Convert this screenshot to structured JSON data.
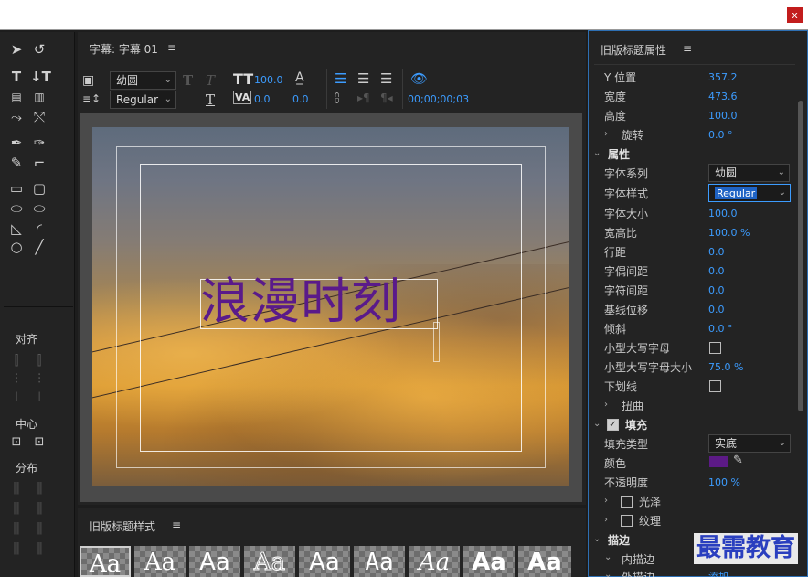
{
  "window": {
    "close_label": "x"
  },
  "title_panel": {
    "title": "字幕: 字幕 01",
    "menu_icon": "≡"
  },
  "toolbar": {
    "font_family": "幼圆",
    "font_style": "Regular",
    "font_size": "100.0",
    "tracking": "0.0",
    "kerning": "0.0",
    "timecode": "00;00;00;03"
  },
  "tools": {
    "align_label": "对齐",
    "center_label": "中心",
    "distribute_label": "分布"
  },
  "canvas": {
    "title_text": "浪漫时刻",
    "text_color": "#5a1a8a"
  },
  "properties_panel": {
    "title": "旧版标题属性",
    "menu_icon": "≡",
    "rows": [
      {
        "label": "Y 位置",
        "value": "357.2"
      },
      {
        "label": "宽度",
        "value": "473.6"
      },
      {
        "label": "高度",
        "value": "100.0"
      },
      {
        "label": "旋转",
        "value": "0.0 °"
      }
    ],
    "attributes_section": "属性",
    "font_family_label": "字体系列",
    "font_family_value": "幼圆",
    "font_style_label": "字体样式",
    "font_style_value": "Regular",
    "attrs": [
      {
        "label": "字体大小",
        "value": "100.0"
      },
      {
        "label": "宽高比",
        "value": "100.0 %"
      },
      {
        "label": "行距",
        "value": "0.0"
      },
      {
        "label": "字偶间距",
        "value": "0.0"
      },
      {
        "label": "字符间距",
        "value": "0.0"
      },
      {
        "label": "基线位移",
        "value": "0.0"
      },
      {
        "label": "倾斜",
        "value": "0.0 °"
      }
    ],
    "small_caps_label": "小型大写字母",
    "small_caps_size_label": "小型大写字母大小",
    "small_caps_size_value": "75.0 %",
    "underline_label": "下划线",
    "distort_label": "扭曲",
    "fill_section": "填充",
    "fill_type_label": "填充类型",
    "fill_type_value": "实底",
    "color_label": "颜色",
    "fill_color": "#5c1a86",
    "opacity_label": "不透明度",
    "opacity_value": "100 %",
    "sheen_label": "光泽",
    "texture_label": "纹理",
    "stroke_section": "描边",
    "inner_stroke_label": "内描边",
    "outer_stroke_label": "外描边",
    "add_label": "添加"
  },
  "styles_panel": {
    "title": "旧版标题样式",
    "menu_icon": "≡",
    "samples": [
      "Aa",
      "Aa",
      "Aa",
      "Aa",
      "Aa",
      "Aa",
      "Aa",
      "Aa",
      "Aa"
    ]
  },
  "watermark": {
    "text": "最需教育"
  }
}
